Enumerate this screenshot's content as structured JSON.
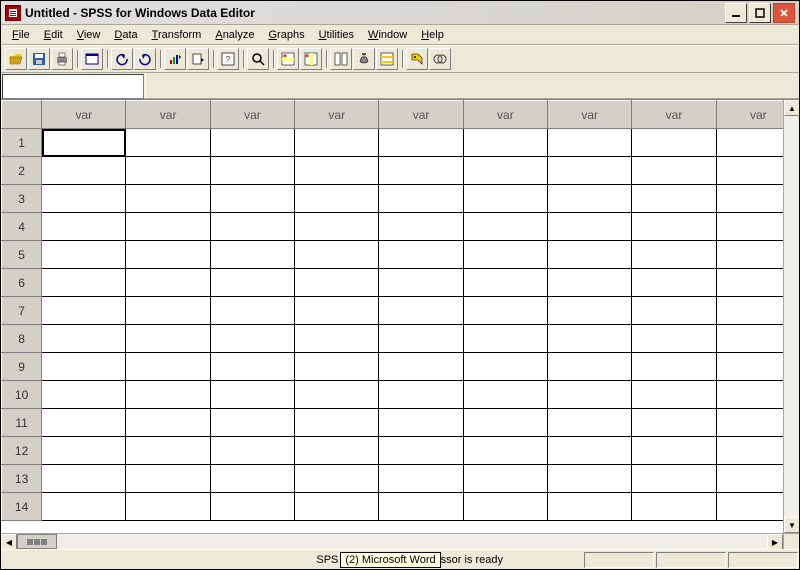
{
  "titlebar": {
    "title": "Untitled - SPSS for Windows Data Editor"
  },
  "menus": [
    {
      "label": "File",
      "accel": "F"
    },
    {
      "label": "Edit",
      "accel": "E"
    },
    {
      "label": "View",
      "accel": "V"
    },
    {
      "label": "Data",
      "accel": "D"
    },
    {
      "label": "Transform",
      "accel": "T"
    },
    {
      "label": "Analyze",
      "accel": "A"
    },
    {
      "label": "Graphs",
      "accel": "G"
    },
    {
      "label": "Utilities",
      "accel": "U"
    },
    {
      "label": "Window",
      "accel": "W"
    },
    {
      "label": "Help",
      "accel": "H"
    }
  ],
  "toolbar_icons": [
    "open-icon",
    "save-icon",
    "print-icon",
    "|",
    "dialog-recall-icon",
    "|",
    "undo-icon",
    "redo-icon",
    "|",
    "goto-chart-icon",
    "goto-case-icon",
    "|",
    "variables-icon",
    "|",
    "find-icon",
    "|",
    "insert-case-icon",
    "insert-variable-icon",
    "|",
    "split-file-icon",
    "weight-cases-icon",
    "select-cases-icon",
    "|",
    "value-labels-icon",
    "use-sets-icon"
  ],
  "grid": {
    "column_label": "var",
    "num_visible_columns": 9,
    "num_visible_rows": 14,
    "selected_cell": {
      "row": 1,
      "col": 1
    }
  },
  "statusbar": {
    "left_text": "SPS",
    "tooltip": "(2) Microsoft Word",
    "right_text": "ssor is ready"
  }
}
